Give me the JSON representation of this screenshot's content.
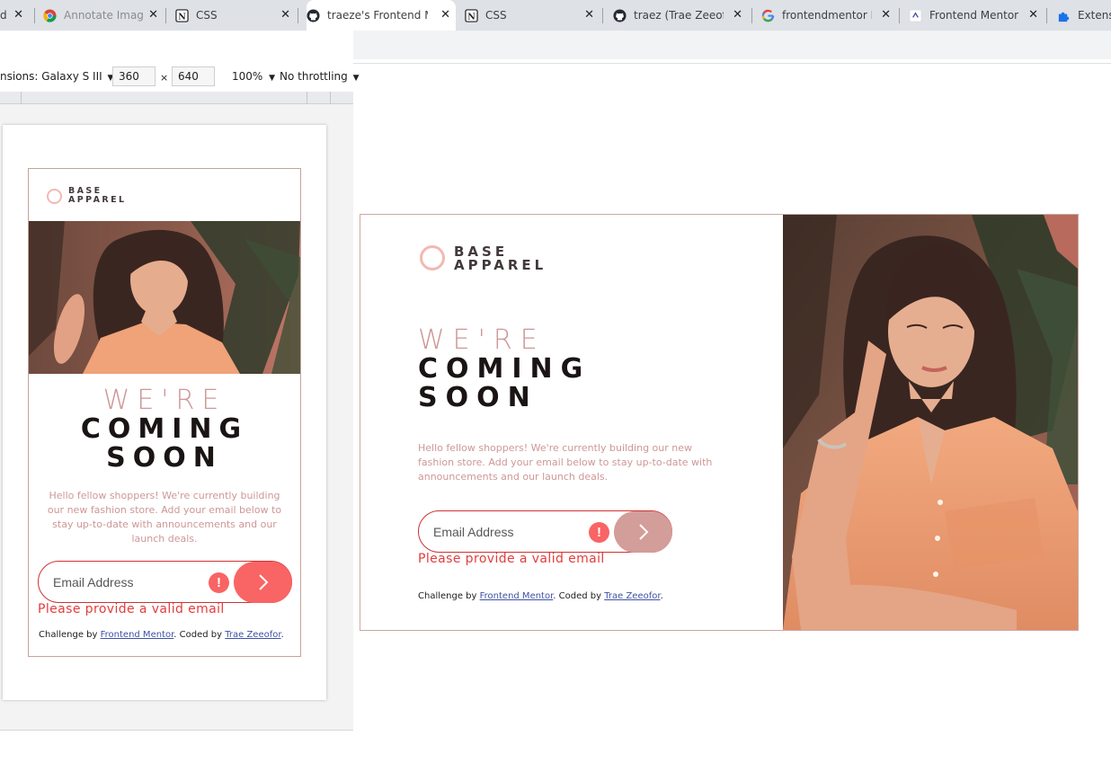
{
  "browser": {
    "tabs": [
      {
        "label": "d",
        "icon": "page-icon"
      },
      {
        "label": "Annotate Imag",
        "icon": "chrome-icon"
      },
      {
        "label": "CSS",
        "icon": "notion-icon"
      },
      {
        "label": "traeze's Frontend Me",
        "icon": "github-icon"
      },
      {
        "label": "CSS",
        "icon": "notion-icon"
      },
      {
        "label": "traez (Trae Zeeofor",
        "icon": "github-icon"
      },
      {
        "label": "frontendmentor Ba",
        "icon": "google-icon"
      },
      {
        "label": "Frontend Mentor |",
        "icon": "frontendmentor-icon"
      },
      {
        "label": "Extens",
        "icon": "puzzle-icon"
      }
    ],
    "close_glyph": "✕"
  },
  "devtools": {
    "dimensions_label": "nsions: Galaxy S III",
    "width_value": "360",
    "times": "×",
    "height_value": "640",
    "zoom": "100%",
    "throttle": "No throttling",
    "caret": "▼"
  },
  "site": {
    "logo_line1": "BASE",
    "logo_line2": "APPAREL",
    "headline_light": "WE'RE",
    "headline_bold_1": "COMING",
    "headline_bold_2": "SOON",
    "description": "Hello fellow shoppers! We're currently building our new fashion store. Add your email below to stay up-to-date with announcements and our launch deals.",
    "email_placeholder": "Email Address",
    "error_icon": "!",
    "error_message": "Please provide a valid email",
    "credit_prefix": "Challenge by ",
    "credit_link1": "Frontend Mentor",
    "credit_mid": ". Coded by ",
    "credit_link2": "Trae Zeeofor",
    "credit_suffix": "."
  },
  "colors": {
    "desaturated_red": "#ce9797",
    "soft_red": "#f96464",
    "dark_grayish_red": "#423a3a",
    "error_red": "#e23d3d"
  }
}
